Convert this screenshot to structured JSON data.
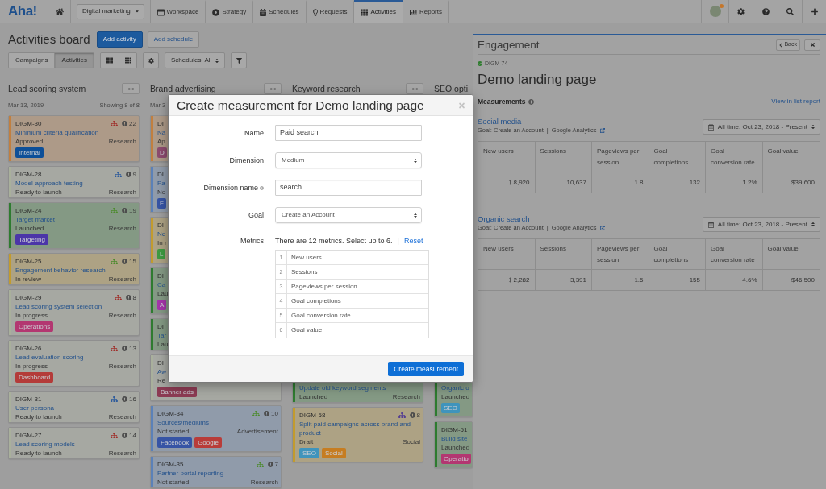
{
  "nav": {
    "logo": "Aha!",
    "workspace_menu": "Digital marketing",
    "tabs": [
      {
        "label": "Workspace",
        "selected": false
      },
      {
        "label": "Strategy",
        "selected": false
      },
      {
        "label": "Schedules",
        "selected": false
      },
      {
        "label": "Requests",
        "selected": false
      },
      {
        "label": "Activities",
        "selected": true
      },
      {
        "label": "Reports",
        "selected": false
      }
    ]
  },
  "board": {
    "title": "Activities board",
    "actions": [
      {
        "label": "Add activity",
        "kind": "primary"
      },
      {
        "label": "Add schedule",
        "kind": "secondary"
      }
    ],
    "view_toggle": [
      {
        "label": "Campaigns",
        "selected": false
      },
      {
        "label": "Activities",
        "selected": true
      }
    ],
    "schedule_filter": "Schedules: All",
    "columns": [
      {
        "title": "Lead scoring system",
        "kind": "open",
        "menu_button": true,
        "date": "Mar 13, 2019",
        "count": "Showing 8 of 8",
        "cards": [
          {
            "kind": "full",
            "id": "DIGM-30",
            "count": "22",
            "hierarchy_icon": {
              "color": "#a02f2b"
            },
            "title": "Minimum criteria qualification",
            "status": "Approved",
            "category": "Research",
            "color": "#c17f3f",
            "tags": [
              {
                "label": "Internal",
                "color": "#0d4f98"
              }
            ]
          },
          {
            "kind": "full",
            "id": "DIGM-28",
            "count": "9",
            "hierarchy_icon": {
              "color": "#2f5c9c"
            },
            "title": "Model-approach testing",
            "status": "Ready to launch",
            "category": "Research",
            "color": "#a9b09c"
          },
          {
            "kind": "full",
            "id": "DIGM-24",
            "count": "19",
            "hierarchy_icon": {
              "color": "#4c8b2d"
            },
            "title": "Target market",
            "status": "Launched",
            "category": "Research",
            "color": "#2e7b30",
            "tags": [
              {
                "label": "Targeting",
                "color": "#4b35a8"
              }
            ]
          },
          {
            "kind": "full",
            "id": "DIGM-25",
            "count": "15",
            "hierarchy_icon": {
              "color": "#4c8b2d"
            },
            "title": "Engagement behavior research",
            "status": "In review",
            "category": "Research",
            "color": "#c29b2e"
          },
          {
            "kind": "full",
            "id": "DIGM-29",
            "count": "8",
            "hierarchy_icon": {
              "color": "#a02f2b"
            },
            "title": "Lead scoring system selection",
            "status": "In progress",
            "category": "Research",
            "color": "#a9b09c",
            "tags": [
              {
                "label": "Operations",
                "color": "#b33771"
              }
            ]
          },
          {
            "kind": "full",
            "id": "DIGM-26",
            "count": "13",
            "hierarchy_icon": {
              "color": "#a02f2b"
            },
            "title": "Lead evaluation scoring",
            "status": "In progress",
            "category": "Research",
            "color": "#a9b09c",
            "tags": [
              {
                "label": "Dashboard",
                "color": "#b43b39"
              }
            ]
          },
          {
            "kind": "full",
            "id": "DIGM-31",
            "count": "16",
            "hierarchy_icon": {
              "color": "#2f5c9c"
            },
            "title": "User persona",
            "status": "Ready to launch",
            "category": "Research",
            "color": "#a9b09c"
          },
          {
            "kind": "full",
            "id": "DIGM-27",
            "count": "14",
            "hierarchy_icon": {
              "color": "#a02f2b"
            },
            "title": "Lead scoring models",
            "status": "Ready to launch",
            "category": "Research",
            "color": "#a9b09c"
          }
        ]
      },
      {
        "title": "Brand advertising",
        "kind": "open",
        "menu_button": true,
        "date": "Mar 3",
        "cards": [
          {
            "kind": "partial",
            "id": "DI",
            "title": "Na",
            "status": "Ap",
            "color": "#c17f3f",
            "tags": [
              {
                "label": "D",
                "color": "#8d4b6f"
              }
            ]
          },
          {
            "kind": "partial",
            "id": "DI",
            "title": "Pa",
            "status": "No",
            "color": "#5b81b8",
            "tags": [
              {
                "label": "F",
                "color": "#3654a5"
              }
            ]
          },
          {
            "kind": "partial",
            "id": "DI",
            "title": "Ne",
            "status": "In r",
            "color": "#c29b2e",
            "tags": [
              {
                "label": "L",
                "color": "#3e9b41"
              }
            ]
          },
          {
            "kind": "partial",
            "id": "DI",
            "title": "Ca",
            "status": "Lau",
            "color": "#2e7b30",
            "tags": [
              {
                "label": "A",
                "color": "#a634ab"
              }
            ]
          },
          {
            "kind": "partial",
            "id": "DI",
            "title": "Tar",
            "status": "Lau",
            "color": "#2e7b30"
          },
          {
            "kind": "full",
            "id": "DI",
            "title": "Aw",
            "status": "Re",
            "color": "#a9b09c",
            "tags": [
              {
                "label": "Banner ads",
                "color": "#8c3b53"
              }
            ]
          },
          {
            "kind": "full",
            "id": "DIGM-34",
            "count": "10",
            "hierarchy_icon": {
              "color": "#4c8b2d"
            },
            "title": "Sources/mediums",
            "status": "Not started",
            "category": "Advertisement",
            "color": "#5b81b8",
            "tags": [
              {
                "label": "Facebook",
                "color": "#3654a5"
              },
              {
                "label": "Google",
                "color": "#b93c39"
              }
            ]
          },
          {
            "kind": "full",
            "id": "DIGM-35",
            "count": "7",
            "hierarchy_icon": {
              "color": "#4c8b2d"
            },
            "title": "Partner portal reporting",
            "status": "Not started",
            "category": "Research",
            "color": "#5b81b8"
          }
        ]
      },
      {
        "title": "Keyword research",
        "kind": "covered",
        "menu_button": true,
        "cards": [
          {
            "kind": "full",
            "title": "Update old keyword segments",
            "status": "Launched",
            "category": "Research",
            "color": "#2e7b30"
          },
          {
            "kind": "full",
            "id": "DIGM-58",
            "count": "8",
            "hierarchy_icon": {
              "color": "#553f92"
            },
            "title": "Split paid campaigns across brand and product",
            "status": "Draft",
            "category": "Social",
            "color": "#c29b2e",
            "tags": [
              {
                "label": "SEO",
                "color": "#3f94bc"
              },
              {
                "label": "Social",
                "color": "#c67d21"
              }
            ]
          }
        ]
      },
      {
        "title": "SEO opti",
        "kind": "covered",
        "menu_button": false,
        "cards": [
          {
            "kind": "full",
            "title": "Organic o",
            "status": "Launched",
            "color": "#2e7b30",
            "tags": [
              {
                "label": "SEO",
                "color": "#3f94bc"
              }
            ]
          },
          {
            "kind": "full",
            "id": "DIGM-51",
            "title": "Build site",
            "status": "Launched",
            "color": "#2e7b30",
            "tags": [
              {
                "label": "Operatio",
                "color": "#b33771"
              }
            ]
          }
        ]
      }
    ]
  },
  "detail_panel": {
    "section": "Engagement",
    "back_label": "Back",
    "record_id": "DIGM-74",
    "title": "Demo landing page",
    "measurements_heading": "Measurements",
    "list_report_link": "View in list report",
    "measurements": [
      {
        "name": "Social media",
        "goal": "Goal: Create an Account",
        "separator": "|",
        "source": "Google Analytics",
        "date_range": "All time: Oct 23, 2018 - Present",
        "columns": [
          "New users",
          "Sessions",
          "Pageviews per session",
          "Goal completions",
          "Goal conversion rate",
          "Goal value"
        ],
        "values": [
          "8,920",
          "10,637",
          "1.8",
          "132",
          "1.2%",
          "$39,600"
        ]
      },
      {
        "name": "Organic search",
        "goal": "Goal: Create an Account",
        "separator": "|",
        "source": "Google Analytics",
        "date_range": "All time: Oct 23, 2018 - Present",
        "columns": [
          "New users",
          "Sessions",
          "Pageviews per session",
          "Goal completions",
          "Goal conversion rate",
          "Goal value"
        ],
        "values": [
          "2,282",
          "3,391",
          "1.5",
          "155",
          "4.6%",
          "$46,500"
        ]
      }
    ]
  },
  "modal": {
    "title": "Create measurement for Demo landing page",
    "fields": [
      {
        "label": "Name",
        "kind": "text",
        "value": "Paid search",
        "info": false
      },
      {
        "label": "Dimension",
        "kind": "select",
        "value": "Medium",
        "info": false
      },
      {
        "label": "Dimension name",
        "kind": "text",
        "value": "search",
        "info": true
      },
      {
        "label": "Goal",
        "kind": "select",
        "value": "Create an Account",
        "info": false
      }
    ],
    "metrics_label": "Metrics",
    "metrics_hint": "There are 12 metrics. Select up to 6.",
    "separator": "|",
    "reset_link": "Reset",
    "metrics": [
      {
        "number": "1",
        "name": "New users"
      },
      {
        "number": "2",
        "name": "Sessions"
      },
      {
        "number": "3",
        "name": "Pageviews per session"
      },
      {
        "number": "4",
        "name": "Goal completions"
      },
      {
        "number": "5",
        "name": "Goal conversion rate"
      },
      {
        "number": "6",
        "name": "Goal value"
      }
    ],
    "submit": "Create measurement"
  }
}
